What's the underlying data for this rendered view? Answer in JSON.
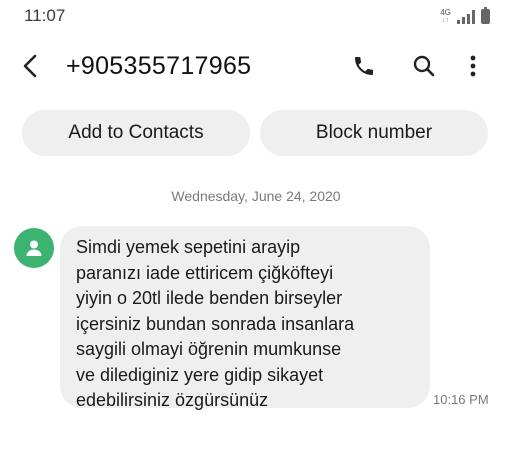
{
  "status_bar": {
    "time": "11:07",
    "network_label": "4G",
    "network_arrows": "↓↑"
  },
  "header": {
    "contact_number": "+905355717965",
    "icons": [
      "back-icon",
      "call-icon",
      "search-icon",
      "more-icon"
    ]
  },
  "actions": {
    "add_to_contacts": "Add to Contacts",
    "block_number": "Block number"
  },
  "conversation": {
    "date": "Wednesday, June 24, 2020",
    "messages": [
      {
        "text": "Simdi yemek sepetini arayip\nparanızı iade ettiricem çiğköfteyi\nyiyin o 20tl ilede benden birseyler\niçersiniz bundan sonrada insanlara\nsaygili olmayi öğrenin mumkunse\nve dilediginiz yere gidip sikayet\nedebilirsiniz özgürsünüz",
        "time": "10:16 PM"
      }
    ]
  },
  "colors": {
    "avatar": "#3cb371",
    "bubble": "#efefef",
    "button": "#efefef",
    "secondary_text": "#7a7a7a"
  }
}
